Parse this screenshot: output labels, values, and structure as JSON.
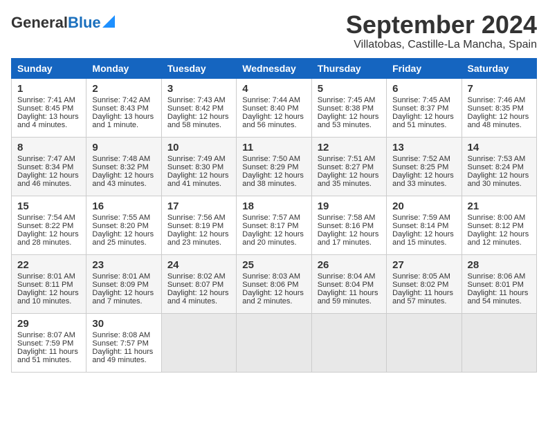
{
  "header": {
    "logo_general": "General",
    "logo_blue": "Blue",
    "title": "September 2024",
    "subtitle": "Villatobas, Castille-La Mancha, Spain"
  },
  "days_of_week": [
    "Sunday",
    "Monday",
    "Tuesday",
    "Wednesday",
    "Thursday",
    "Friday",
    "Saturday"
  ],
  "weeks": [
    [
      {
        "day": "1",
        "sunrise": "Sunrise: 7:41 AM",
        "sunset": "Sunset: 8:45 PM",
        "daylight": "Daylight: 13 hours and 4 minutes."
      },
      {
        "day": "2",
        "sunrise": "Sunrise: 7:42 AM",
        "sunset": "Sunset: 8:43 PM",
        "daylight": "Daylight: 13 hours and 1 minute."
      },
      {
        "day": "3",
        "sunrise": "Sunrise: 7:43 AM",
        "sunset": "Sunset: 8:42 PM",
        "daylight": "Daylight: 12 hours and 58 minutes."
      },
      {
        "day": "4",
        "sunrise": "Sunrise: 7:44 AM",
        "sunset": "Sunset: 8:40 PM",
        "daylight": "Daylight: 12 hours and 56 minutes."
      },
      {
        "day": "5",
        "sunrise": "Sunrise: 7:45 AM",
        "sunset": "Sunset: 8:38 PM",
        "daylight": "Daylight: 12 hours and 53 minutes."
      },
      {
        "day": "6",
        "sunrise": "Sunrise: 7:45 AM",
        "sunset": "Sunset: 8:37 PM",
        "daylight": "Daylight: 12 hours and 51 minutes."
      },
      {
        "day": "7",
        "sunrise": "Sunrise: 7:46 AM",
        "sunset": "Sunset: 8:35 PM",
        "daylight": "Daylight: 12 hours and 48 minutes."
      }
    ],
    [
      {
        "day": "8",
        "sunrise": "Sunrise: 7:47 AM",
        "sunset": "Sunset: 8:34 PM",
        "daylight": "Daylight: 12 hours and 46 minutes."
      },
      {
        "day": "9",
        "sunrise": "Sunrise: 7:48 AM",
        "sunset": "Sunset: 8:32 PM",
        "daylight": "Daylight: 12 hours and 43 minutes."
      },
      {
        "day": "10",
        "sunrise": "Sunrise: 7:49 AM",
        "sunset": "Sunset: 8:30 PM",
        "daylight": "Daylight: 12 hours and 41 minutes."
      },
      {
        "day": "11",
        "sunrise": "Sunrise: 7:50 AM",
        "sunset": "Sunset: 8:29 PM",
        "daylight": "Daylight: 12 hours and 38 minutes."
      },
      {
        "day": "12",
        "sunrise": "Sunrise: 7:51 AM",
        "sunset": "Sunset: 8:27 PM",
        "daylight": "Daylight: 12 hours and 35 minutes."
      },
      {
        "day": "13",
        "sunrise": "Sunrise: 7:52 AM",
        "sunset": "Sunset: 8:25 PM",
        "daylight": "Daylight: 12 hours and 33 minutes."
      },
      {
        "day": "14",
        "sunrise": "Sunrise: 7:53 AM",
        "sunset": "Sunset: 8:24 PM",
        "daylight": "Daylight: 12 hours and 30 minutes."
      }
    ],
    [
      {
        "day": "15",
        "sunrise": "Sunrise: 7:54 AM",
        "sunset": "Sunset: 8:22 PM",
        "daylight": "Daylight: 12 hours and 28 minutes."
      },
      {
        "day": "16",
        "sunrise": "Sunrise: 7:55 AM",
        "sunset": "Sunset: 8:20 PM",
        "daylight": "Daylight: 12 hours and 25 minutes."
      },
      {
        "day": "17",
        "sunrise": "Sunrise: 7:56 AM",
        "sunset": "Sunset: 8:19 PM",
        "daylight": "Daylight: 12 hours and 23 minutes."
      },
      {
        "day": "18",
        "sunrise": "Sunrise: 7:57 AM",
        "sunset": "Sunset: 8:17 PM",
        "daylight": "Daylight: 12 hours and 20 minutes."
      },
      {
        "day": "19",
        "sunrise": "Sunrise: 7:58 AM",
        "sunset": "Sunset: 8:16 PM",
        "daylight": "Daylight: 12 hours and 17 minutes."
      },
      {
        "day": "20",
        "sunrise": "Sunrise: 7:59 AM",
        "sunset": "Sunset: 8:14 PM",
        "daylight": "Daylight: 12 hours and 15 minutes."
      },
      {
        "day": "21",
        "sunrise": "Sunrise: 8:00 AM",
        "sunset": "Sunset: 8:12 PM",
        "daylight": "Daylight: 12 hours and 12 minutes."
      }
    ],
    [
      {
        "day": "22",
        "sunrise": "Sunrise: 8:01 AM",
        "sunset": "Sunset: 8:11 PM",
        "daylight": "Daylight: 12 hours and 10 minutes."
      },
      {
        "day": "23",
        "sunrise": "Sunrise: 8:01 AM",
        "sunset": "Sunset: 8:09 PM",
        "daylight": "Daylight: 12 hours and 7 minutes."
      },
      {
        "day": "24",
        "sunrise": "Sunrise: 8:02 AM",
        "sunset": "Sunset: 8:07 PM",
        "daylight": "Daylight: 12 hours and 4 minutes."
      },
      {
        "day": "25",
        "sunrise": "Sunrise: 8:03 AM",
        "sunset": "Sunset: 8:06 PM",
        "daylight": "Daylight: 12 hours and 2 minutes."
      },
      {
        "day": "26",
        "sunrise": "Sunrise: 8:04 AM",
        "sunset": "Sunset: 8:04 PM",
        "daylight": "Daylight: 11 hours and 59 minutes."
      },
      {
        "day": "27",
        "sunrise": "Sunrise: 8:05 AM",
        "sunset": "Sunset: 8:02 PM",
        "daylight": "Daylight: 11 hours and 57 minutes."
      },
      {
        "day": "28",
        "sunrise": "Sunrise: 8:06 AM",
        "sunset": "Sunset: 8:01 PM",
        "daylight": "Daylight: 11 hours and 54 minutes."
      }
    ],
    [
      {
        "day": "29",
        "sunrise": "Sunrise: 8:07 AM",
        "sunset": "Sunset: 7:59 PM",
        "daylight": "Daylight: 11 hours and 51 minutes."
      },
      {
        "day": "30",
        "sunrise": "Sunrise: 8:08 AM",
        "sunset": "Sunset: 7:57 PM",
        "daylight": "Daylight: 11 hours and 49 minutes."
      },
      {
        "day": "",
        "sunrise": "",
        "sunset": "",
        "daylight": ""
      },
      {
        "day": "",
        "sunrise": "",
        "sunset": "",
        "daylight": ""
      },
      {
        "day": "",
        "sunrise": "",
        "sunset": "",
        "daylight": ""
      },
      {
        "day": "",
        "sunrise": "",
        "sunset": "",
        "daylight": ""
      },
      {
        "day": "",
        "sunrise": "",
        "sunset": "",
        "daylight": ""
      }
    ]
  ]
}
